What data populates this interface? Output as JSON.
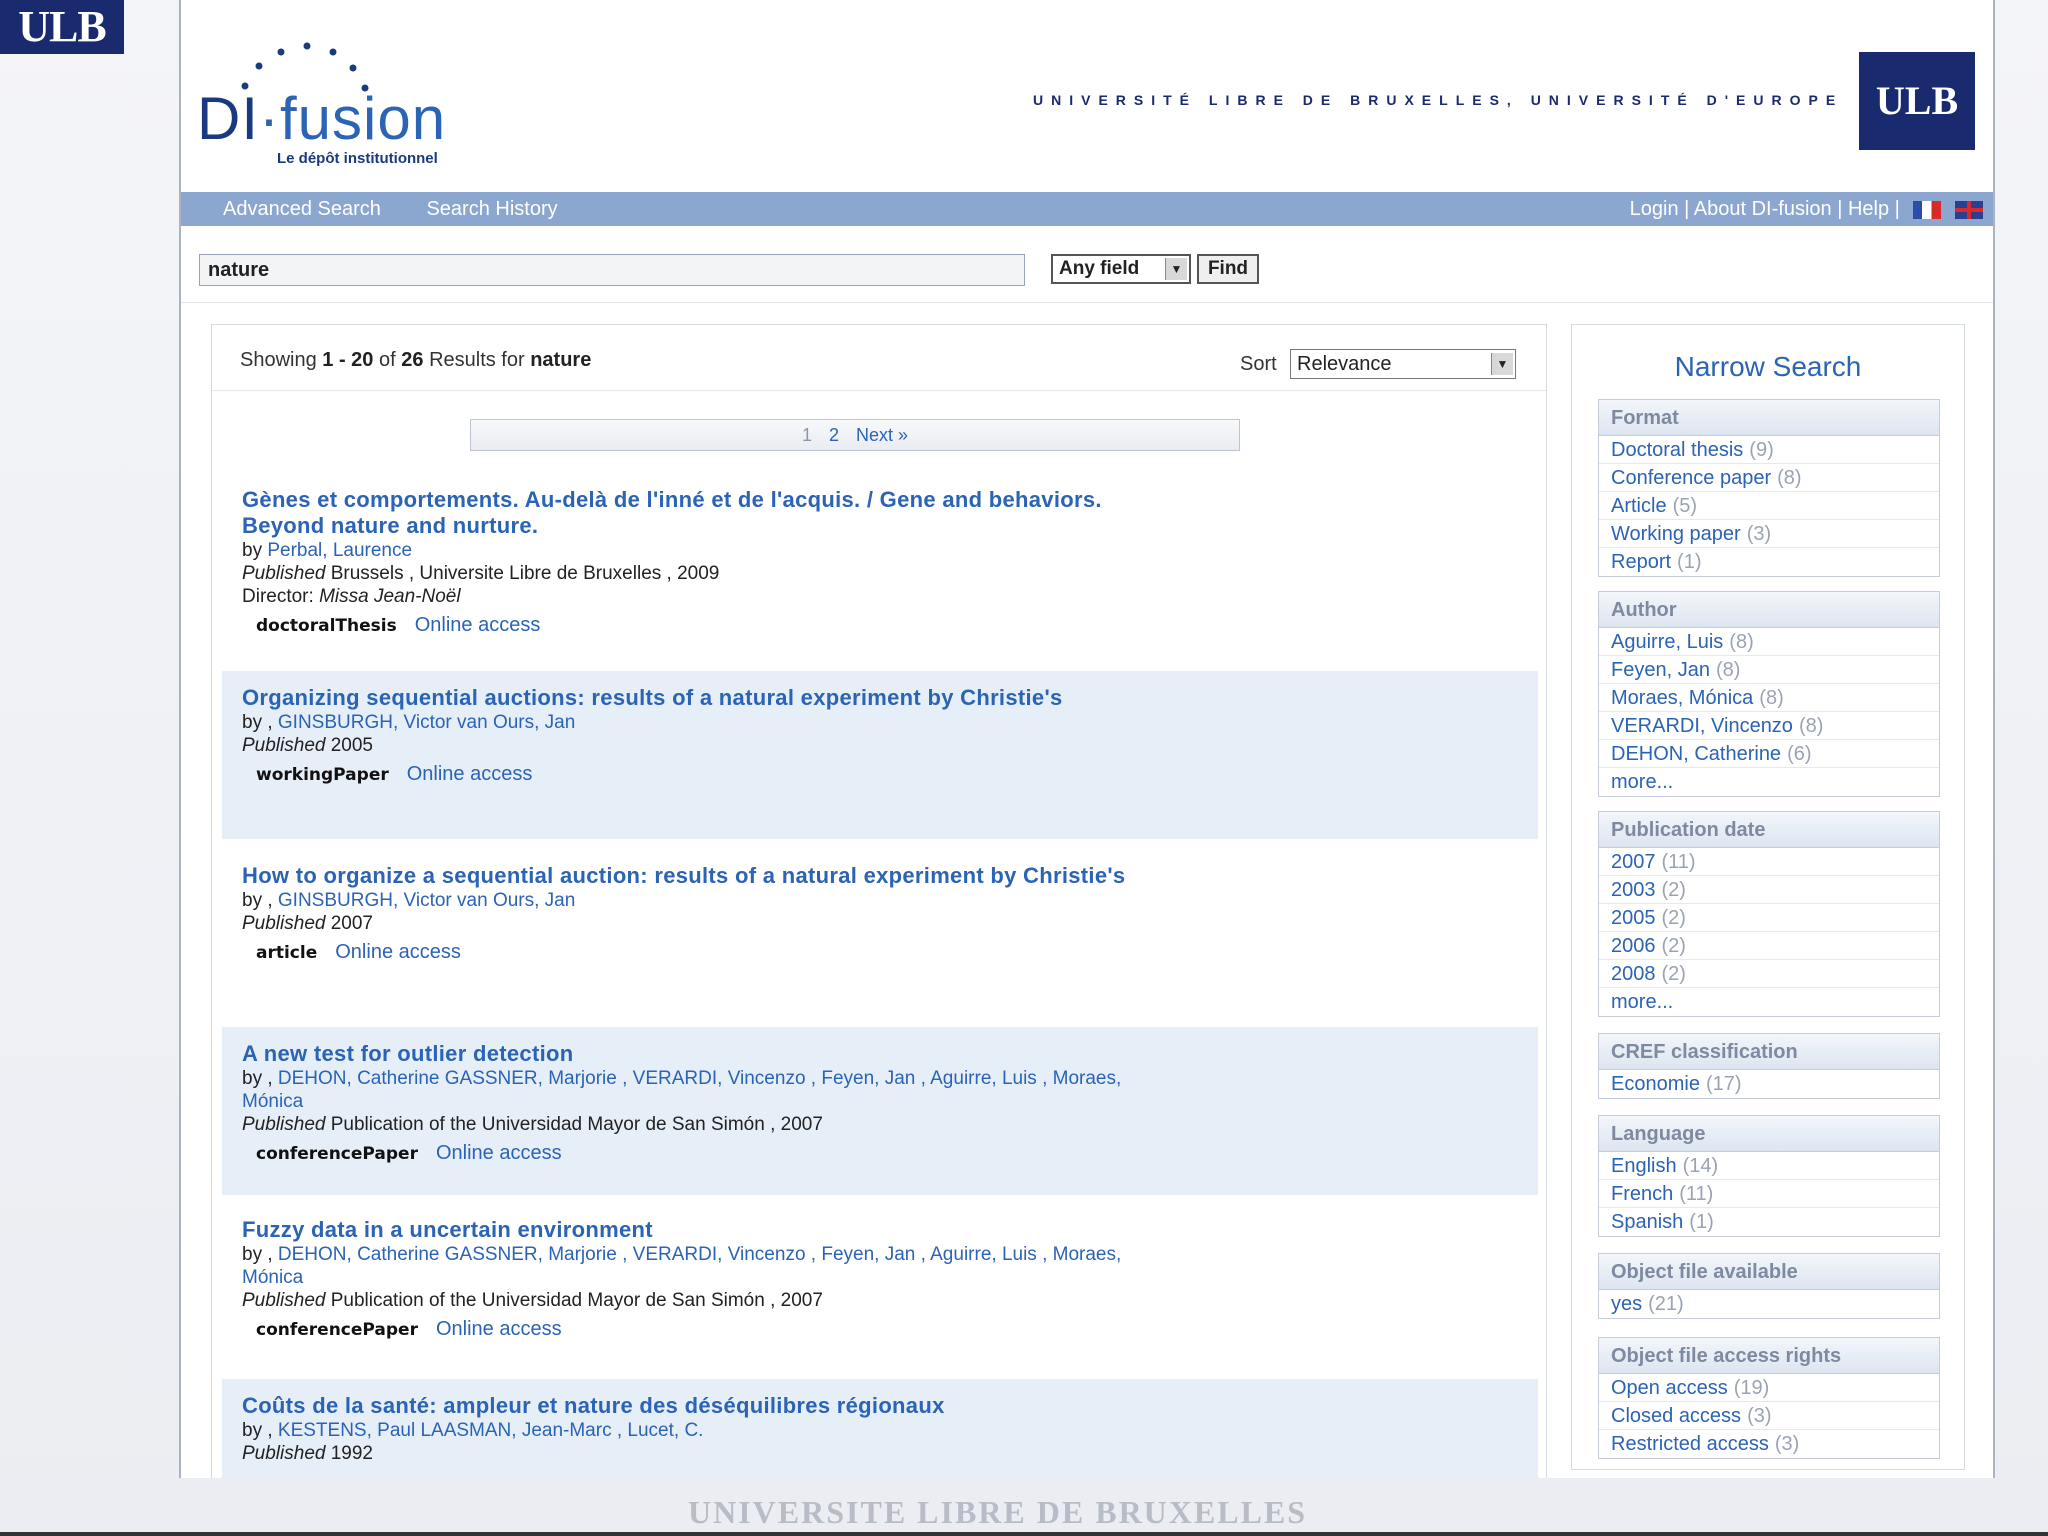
{
  "corner_logo": "ULB",
  "header": {
    "brand_di": "DI",
    "brand_dot": "·",
    "brand_fusion": "fusion",
    "brand_sub": "Le dépôt institutionnel",
    "university_line": "UNIVERSITÉ LIBRE DE BRUXELLES, UNIVERSITÉ D'EUROPE",
    "ulb_logo": "ULB"
  },
  "nav": {
    "advanced_search": "Advanced Search",
    "search_history": "Search History",
    "login": "Login",
    "about": "About DI-fusion",
    "help": "Help",
    "sep": "|"
  },
  "search": {
    "query": "nature",
    "field": "Any field",
    "find_label": "Find"
  },
  "results": {
    "showing_prefix": "Showing",
    "range": "1 - 20",
    "of": "of",
    "total": "26",
    "results_for": "Results for",
    "query": "nature",
    "sort_label": "Sort",
    "sort_value": "Relevance",
    "pager": {
      "page1": "1",
      "page2": "2",
      "next": "Next »"
    },
    "online_access": "Online access",
    "records": [
      {
        "title": "Gènes et comportements. Au-delà de l'inné et de l'acquis. / Gene and behaviors. Beyond nature and nurture.",
        "by": "by",
        "authors": "Perbal, Laurence",
        "published_label": "Published",
        "published": "Brussels , Universite Libre de Bruxelles , 2009",
        "director_label": "Director:",
        "director": "Missa Jean-Noël",
        "type": "doctoralThesis"
      },
      {
        "title": "Organizing sequential auctions: results of a natural experiment by Christie's",
        "by": "by ,",
        "authors": "GINSBURGH, Victor van Ours, Jan",
        "published_label": "Published",
        "published": "2005",
        "type": "workingPaper"
      },
      {
        "title": "How to organize a sequential auction: results of a natural experiment by Christie's",
        "by": "by ,",
        "authors": "GINSBURGH, Victor van Ours, Jan",
        "published_label": "Published",
        "published": "2007",
        "type": "article"
      },
      {
        "title": "A new test for outlier detection",
        "by": "by ,",
        "authors": "DEHON, Catherine GASSNER, Marjorie , VERARDI, Vincenzo , Feyen, Jan , Aguirre, Luis , Moraes, Mónica",
        "published_label": "Published",
        "published": "Publication of the Universidad Mayor de San Simón , 2007",
        "type": "conferencePaper"
      },
      {
        "title": "Fuzzy data in a uncertain environment",
        "by": "by ,",
        "authors": "DEHON, Catherine GASSNER, Marjorie , VERARDI, Vincenzo , Feyen, Jan , Aguirre, Luis , Moraes, Mónica",
        "published_label": "Published",
        "published": "Publication of the Universidad Mayor de San Simón , 2007",
        "type": "conferencePaper"
      },
      {
        "title": "Coûts de la santé: ampleur et nature des déséquilibres régionaux",
        "by": "by ,",
        "authors": "KESTENS, Paul LAASMAN, Jean-Marc , Lucet, C.",
        "published_label": "Published",
        "published": "1992"
      }
    ]
  },
  "sidebar": {
    "title": "Narrow Search",
    "facets": [
      {
        "name": "Format",
        "items": [
          {
            "label": "Doctoral thesis",
            "count": "(9)"
          },
          {
            "label": "Conference paper",
            "count": "(8)"
          },
          {
            "label": "Article",
            "count": "(5)"
          },
          {
            "label": "Working paper",
            "count": "(3)"
          },
          {
            "label": "Report",
            "count": "(1)"
          }
        ]
      },
      {
        "name": "Author",
        "items": [
          {
            "label": "Aguirre, Luis",
            "count": "(8)"
          },
          {
            "label": "Feyen, Jan",
            "count": "(8)"
          },
          {
            "label": "Moraes, Mónica",
            "count": "(8)"
          },
          {
            "label": "VERARDI, Vincenzo",
            "count": "(8)"
          },
          {
            "label": "DEHON, Catherine",
            "count": "(6)"
          },
          {
            "label": "more...",
            "count": ""
          }
        ]
      },
      {
        "name": "Publication date",
        "items": [
          {
            "label": "2007",
            "count": "(11)"
          },
          {
            "label": "2003",
            "count": "(2)"
          },
          {
            "label": "2005",
            "count": "(2)"
          },
          {
            "label": "2006",
            "count": "(2)"
          },
          {
            "label": "2008",
            "count": "(2)"
          },
          {
            "label": "more...",
            "count": ""
          }
        ]
      },
      {
        "name": "CREF classification",
        "items": [
          {
            "label": "Economie",
            "count": "(17)"
          }
        ]
      },
      {
        "name": "Language",
        "items": [
          {
            "label": "English",
            "count": "(14)"
          },
          {
            "label": "French",
            "count": "(11)"
          },
          {
            "label": "Spanish",
            "count": "(1)"
          }
        ]
      },
      {
        "name": "Object file available",
        "items": [
          {
            "label": "yes",
            "count": "(21)"
          }
        ]
      },
      {
        "name": "Object file access rights",
        "items": [
          {
            "label": "Open access",
            "count": "(19)"
          },
          {
            "label": "Closed access",
            "count": "(3)"
          },
          {
            "label": "Restricted access",
            "count": "(3)"
          }
        ]
      }
    ]
  },
  "footer": {
    "university": "UNIVERSITE LIBRE DE BRUXELLES"
  },
  "colors": {
    "brand_blue": "#1a2a6e",
    "link_blue": "#2b63b5",
    "nav_bar": "#8ba6cf",
    "alt_row": "#e6eef8"
  }
}
